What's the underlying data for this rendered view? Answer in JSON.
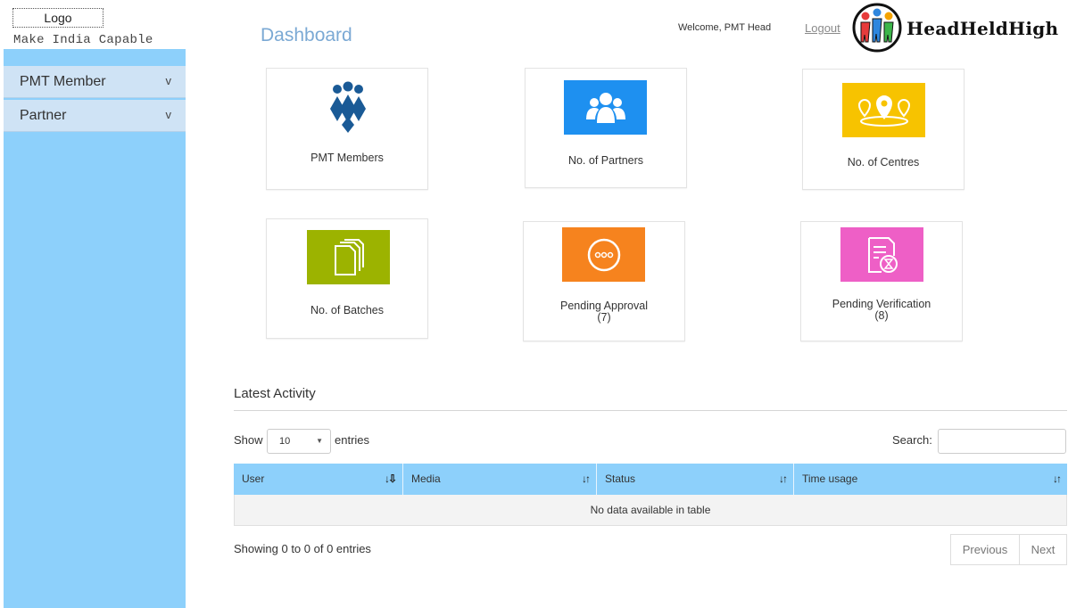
{
  "brand": {
    "logo_placeholder": "Logo",
    "tagline": "Make India Capable",
    "partner_name": "HeadHeldHigh"
  },
  "sidebar": {
    "items": [
      {
        "label": "PMT Member",
        "chevron": "v"
      },
      {
        "label": "Partner",
        "chevron": "v"
      }
    ]
  },
  "header": {
    "title": "Dashboard",
    "welcome": "Welcome, PMT Head",
    "logout": "Logout"
  },
  "cards": [
    {
      "label": "PMT Members",
      "icon": "people-group-icon",
      "color": "#1a5a96"
    },
    {
      "label": "No. of  Partners",
      "icon": "users-icon",
      "color": "#1e90f0"
    },
    {
      "label": "No. of  Centres",
      "icon": "location-pins-icon",
      "color": "#f7c300"
    },
    {
      "label": "No. of  Batches",
      "icon": "documents-icon",
      "color": "#9cb300"
    },
    {
      "label": "Pending Approval",
      "count": "(7)",
      "icon": "more-dots-icon",
      "color": "#f6831e"
    },
    {
      "label": "Pending Verification",
      "count": "(8)",
      "icon": "document-timer-icon",
      "color": "#ee5fc6"
    }
  ],
  "activity": {
    "title": "Latest Activity",
    "show_label": "Show",
    "entries_value": "10",
    "entries_label": "entries",
    "search_label": "Search:",
    "search_value": "",
    "columns": [
      "User",
      "Media",
      "Status",
      "Time usage"
    ],
    "empty_text": "No data available in table",
    "info": "Showing 0 to 0 of 0 entries",
    "prev": "Previous",
    "next": "Next"
  },
  "colors": {
    "sidebar": "#8dd0fb",
    "sidebar_item": "#cfe3f5",
    "table_header": "#8dd0fb",
    "title": "#7ba9d4"
  }
}
